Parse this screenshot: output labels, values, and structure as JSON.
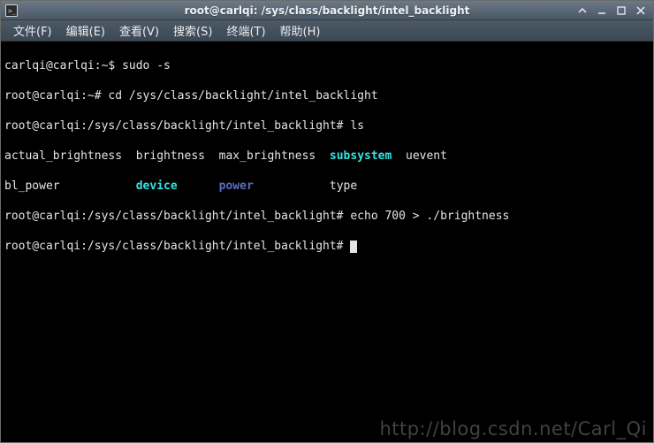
{
  "titlebar": {
    "title": "root@carlqi: /sys/class/backlight/intel_backlight"
  },
  "menubar": {
    "items": [
      "文件(F)",
      "编辑(E)",
      "查看(V)",
      "搜索(S)",
      "终端(T)",
      "帮助(H)"
    ]
  },
  "terminal": {
    "lines": [
      {
        "prompt": "carlqi@carlqi:~$ ",
        "cmd": "sudo -s"
      },
      {
        "prompt": "root@carlqi:~# ",
        "cmd": "cd /sys/class/backlight/intel_backlight"
      },
      {
        "prompt": "root@carlqi:/sys/class/backlight/intel_backlight# ",
        "cmd": "ls"
      }
    ],
    "ls_output": {
      "row1": {
        "c1": "actual_brightness",
        "c2": "brightness",
        "c3": "max_brightness",
        "c4": "subsystem",
        "c5": "uevent"
      },
      "row2": {
        "c1": "bl_power",
        "c2": "device",
        "c3": "power",
        "c4": "type",
        "c5": ""
      }
    },
    "after": [
      {
        "prompt": "root@carlqi:/sys/class/backlight/intel_backlight# ",
        "cmd": "echo 700 > ./brightness"
      },
      {
        "prompt": "root@carlqi:/sys/class/backlight/intel_backlight# ",
        "cmd": ""
      }
    ]
  },
  "watermark": "http://blog.csdn.net/Carl_Qi"
}
